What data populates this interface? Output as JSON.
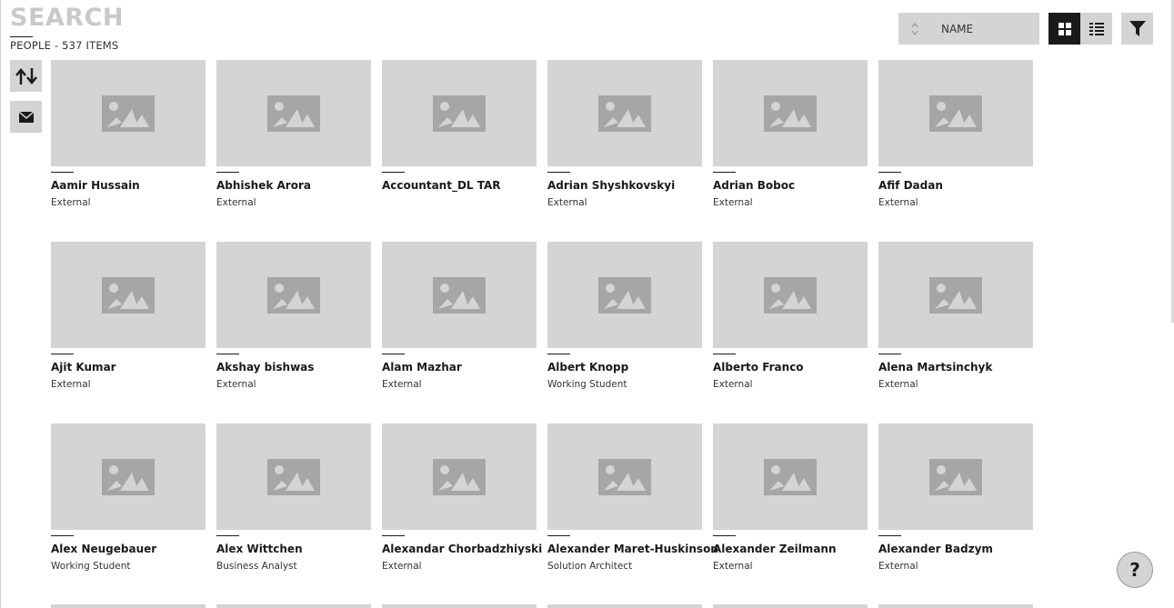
{
  "header": {
    "title": "SEARCH",
    "subtitle": "PEOPLE - 537 ITEMS"
  },
  "toolbar": {
    "sort_label": "NAME",
    "sort_icon": "sort-updown-icon",
    "grid_view_icon": "grid-view-icon",
    "list_view_icon": "list-view-icon",
    "filter_icon": "filter-icon",
    "active_view": "grid"
  },
  "sidebar": {
    "buttons": [
      {
        "icon": "sort-toggle-icon"
      },
      {
        "icon": "mail-icon"
      }
    ]
  },
  "people": [
    {
      "name": "Aamir Hussain",
      "role": "External"
    },
    {
      "name": "Abhishek Arora",
      "role": "External"
    },
    {
      "name": "Accountant_DL TAR",
      "role": ""
    },
    {
      "name": "Adrian Shyshkovskyi",
      "role": "External"
    },
    {
      "name": "Adrian Boboc",
      "role": "External"
    },
    {
      "name": "Afif Dadan",
      "role": "External"
    },
    {
      "name": "Ajit Kumar",
      "role": "External"
    },
    {
      "name": "Akshay bishwas",
      "role": "External"
    },
    {
      "name": "Alam Mazhar",
      "role": "External"
    },
    {
      "name": "Albert Knopp",
      "role": "Working Student"
    },
    {
      "name": "Alberto Franco",
      "role": "External"
    },
    {
      "name": "Alena Martsinchyk",
      "role": "External"
    },
    {
      "name": "Alex Neugebauer",
      "role": "Working Student"
    },
    {
      "name": "Alex Wittchen",
      "role": "Business Analyst"
    },
    {
      "name": "Alexandar Chorbadzhiyski",
      "role": "External"
    },
    {
      "name": "Alexander Maret-Huskinson",
      "role": "Solution Architect"
    },
    {
      "name": "Alexander Zeilmann",
      "role": "External"
    },
    {
      "name": "Alexander Badzym",
      "role": "External"
    }
  ],
  "help": {
    "label": "?"
  },
  "colors": {
    "placeholder": "#d4d4d4",
    "placeholder_icon": "#a6a6a6",
    "title": "#c9c9c9",
    "active": "#1a1a1a"
  }
}
